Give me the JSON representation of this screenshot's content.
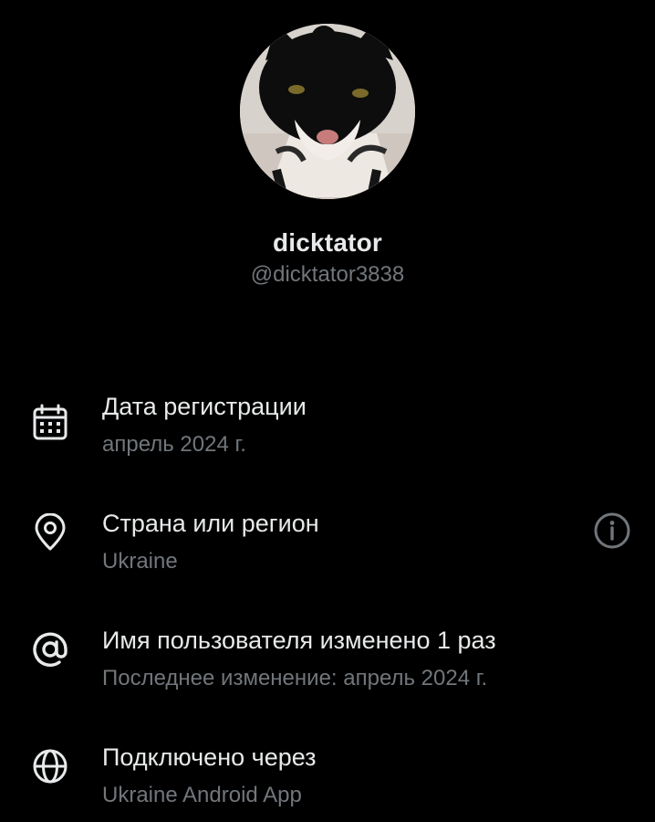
{
  "profile": {
    "display_name": "dicktator",
    "handle": "@dicktator3838",
    "avatar_description": "avatar"
  },
  "info_items": [
    {
      "icon": "calendar-icon",
      "title": "Дата регистрации",
      "value": "апрель 2024 г."
    },
    {
      "icon": "location-pin-icon",
      "title": "Страна или регион",
      "value": "Ukraine",
      "action_icon": "info-icon"
    },
    {
      "icon": "at-sign-icon",
      "title": "Имя пользователя изменено 1 раз",
      "value": "Последнее изменение: апрель 2024 г."
    },
    {
      "icon": "globe-icon",
      "title": "Подключено через",
      "value": "Ukraine Android App"
    }
  ],
  "colors": {
    "background": "#000000",
    "primary_text": "#e7e9ea",
    "secondary_text": "#71767b"
  }
}
